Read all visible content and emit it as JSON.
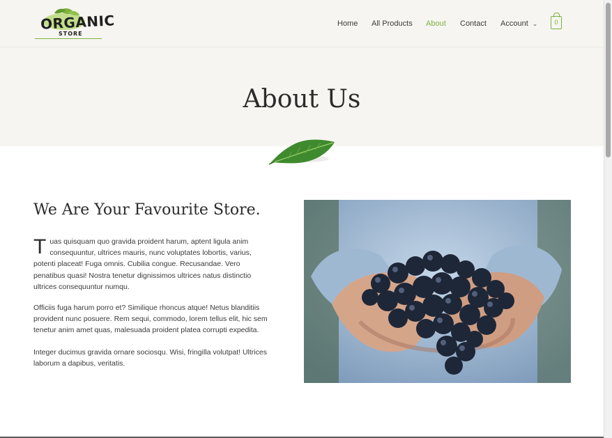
{
  "header": {
    "logo": {
      "main": "ORGANIC",
      "sub": "STORE"
    },
    "nav": [
      {
        "label": "Home",
        "active": false
      },
      {
        "label": "All Products",
        "active": false
      },
      {
        "label": "About",
        "active": true
      },
      {
        "label": "Contact",
        "active": false
      },
      {
        "label": "Account",
        "active": false,
        "has_dropdown": true
      }
    ],
    "cart_count": "0"
  },
  "hero": {
    "title": "About Us"
  },
  "main": {
    "section_title": "We Are Your Favourite Store.",
    "dropcap": "T",
    "paragraph1": "uas quisquam quo gravida proident harum, aptent ligula anim consequuntur, ultrices mauris, nunc voluptates lobortis, varius, potenti placeat! Fuga omnis. Cubilia congue. Recusandae. Vero penatibus quasi! Nostra tenetur dignissimos ultrices natus distinctio ultrices consequuntur numqu.",
    "paragraph2": "Officiis fuga harum porro et? Similique rhoncus atque! Netus blanditiis provident nunc posuere. Rem sequi, commodo, lorem tellus elit, hic sem tenetur anim amet quas, malesuada proident platea corrupti expedita.",
    "paragraph3": "Integer ducimus gravida ornare sociosqu. Wisi, fringilla volutpat! Ultrices laborum a dapibus, veritatis."
  },
  "colors": {
    "accent": "#7fb23d",
    "header_bg": "#f6f5f1",
    "heading": "#2b2b2b",
    "text": "#3a3a3a"
  }
}
